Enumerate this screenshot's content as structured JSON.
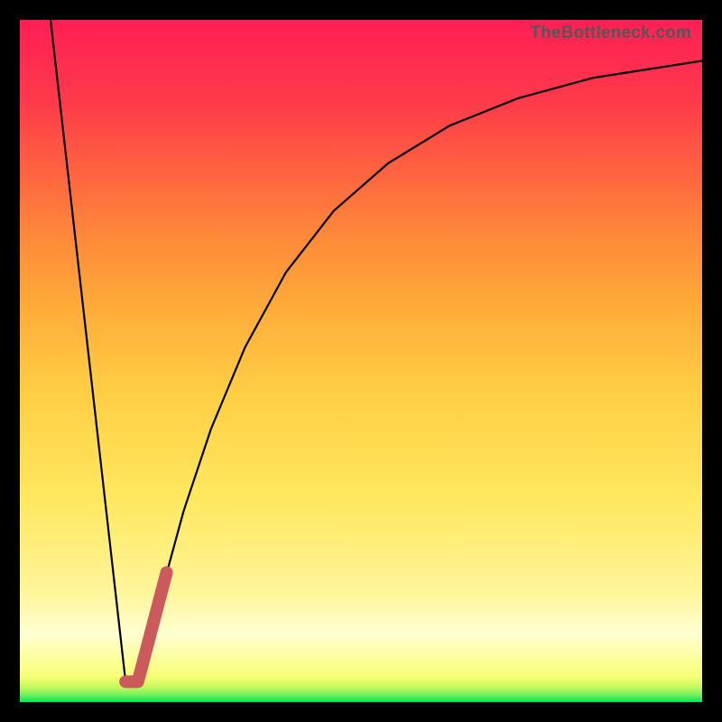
{
  "watermark": "TheBottleneck.com",
  "chart_data": {
    "type": "line",
    "title": "",
    "xlabel": "",
    "ylabel": "",
    "xlim": [
      0,
      100
    ],
    "ylim": [
      0,
      100
    ],
    "grid": false,
    "legend": false,
    "series": [
      {
        "name": "left-descent",
        "stroke": "#000000",
        "width": 2.2,
        "points": [
          {
            "x": 4.5,
            "y": 100
          },
          {
            "x": 15.5,
            "y": 3
          }
        ]
      },
      {
        "name": "right-curve",
        "stroke": "#000000",
        "width": 2.2,
        "points": [
          {
            "x": 17.3,
            "y": 3
          },
          {
            "x": 19.0,
            "y": 9
          },
          {
            "x": 21.0,
            "y": 17
          },
          {
            "x": 24.0,
            "y": 28
          },
          {
            "x": 28.0,
            "y": 40
          },
          {
            "x": 33.0,
            "y": 52
          },
          {
            "x": 39.0,
            "y": 63
          },
          {
            "x": 46.0,
            "y": 72
          },
          {
            "x": 54.0,
            "y": 79
          },
          {
            "x": 63.0,
            "y": 84.5
          },
          {
            "x": 73.0,
            "y": 88.5
          },
          {
            "x": 84.0,
            "y": 91.5
          },
          {
            "x": 100.0,
            "y": 94
          }
        ]
      },
      {
        "name": "red-marker",
        "stroke": "#cc5a5d",
        "width": 14,
        "linecap": "round",
        "points": [
          {
            "x": 15.5,
            "y": 3
          },
          {
            "x": 17.3,
            "y": 3
          },
          {
            "x": 21.5,
            "y": 19
          }
        ]
      }
    ]
  }
}
